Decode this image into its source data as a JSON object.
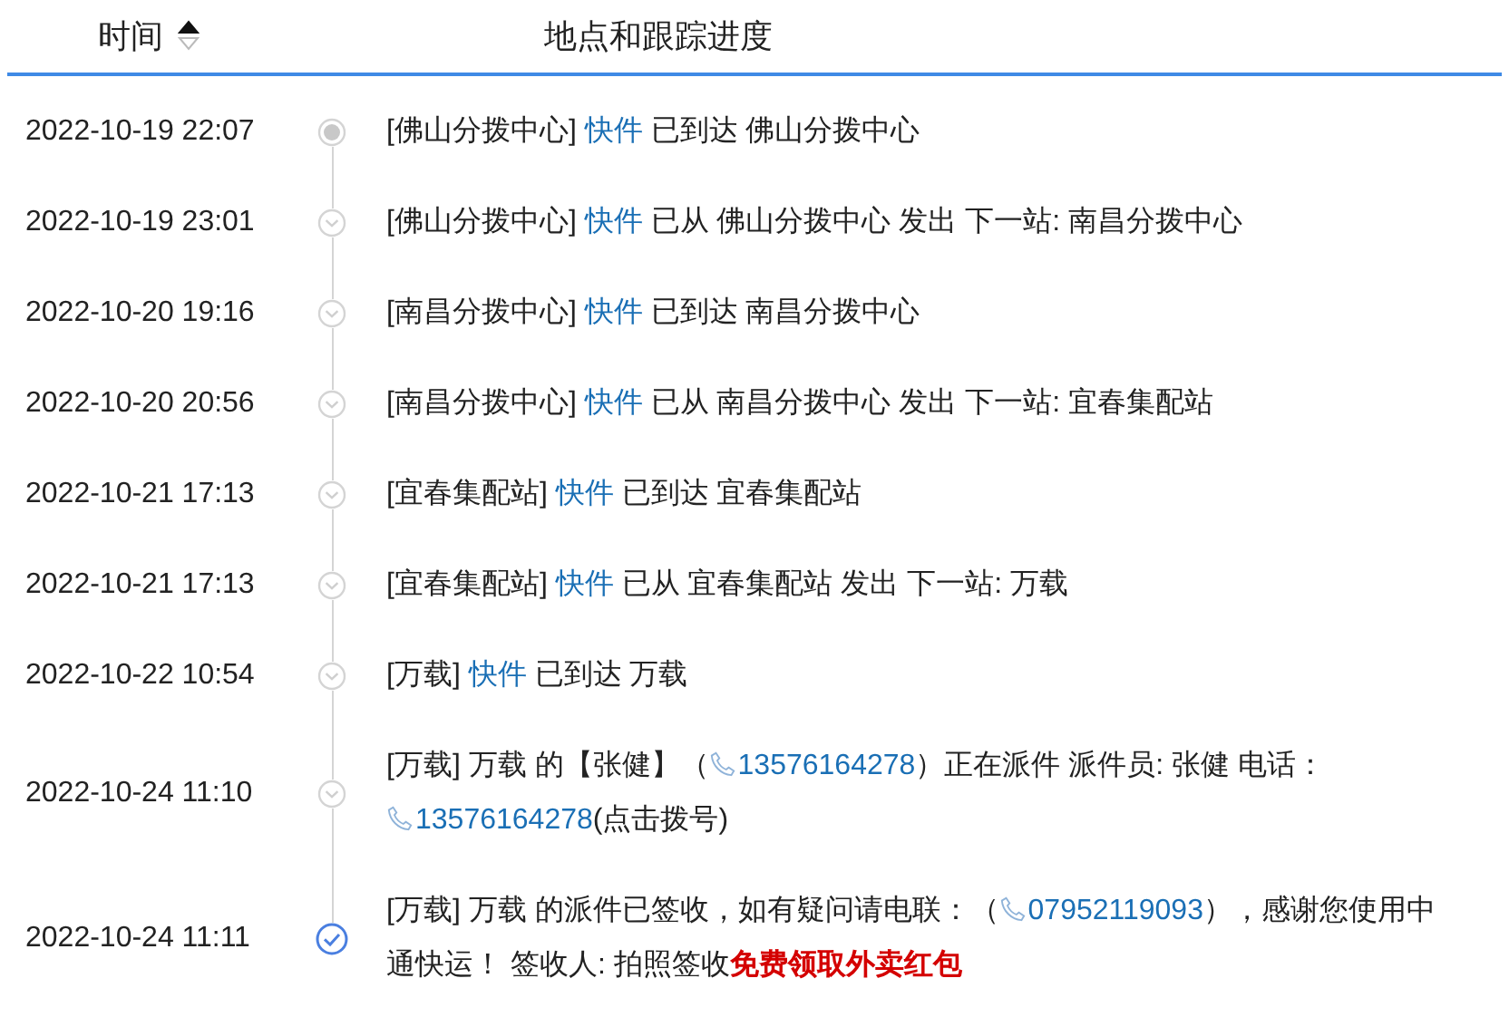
{
  "header": {
    "time_column": "时间",
    "sorted_ascending": true,
    "detail_column": "地点和跟踪进度"
  },
  "events": [
    {
      "time": "2022-10-19 22:07",
      "kind": "start",
      "segments": [
        {
          "kind": "text",
          "text": "[佛山分拨中心] "
        },
        {
          "kind": "link",
          "text": "快件"
        },
        {
          "kind": "text",
          "text": " 已到达 佛山分拨中心"
        }
      ]
    },
    {
      "time": "2022-10-19 23:01",
      "kind": "step",
      "segments": [
        {
          "kind": "text",
          "text": "[佛山分拨中心] "
        },
        {
          "kind": "link",
          "text": "快件"
        },
        {
          "kind": "text",
          "text": " 已从 佛山分拨中心 发出 下一站: 南昌分拨中心"
        }
      ]
    },
    {
      "time": "2022-10-20 19:16",
      "kind": "step",
      "segments": [
        {
          "kind": "text",
          "text": "[南昌分拨中心] "
        },
        {
          "kind": "link",
          "text": "快件"
        },
        {
          "kind": "text",
          "text": " 已到达 南昌分拨中心"
        }
      ]
    },
    {
      "time": "2022-10-20 20:56",
      "kind": "step",
      "segments": [
        {
          "kind": "text",
          "text": "[南昌分拨中心] "
        },
        {
          "kind": "link",
          "text": "快件"
        },
        {
          "kind": "text",
          "text": " 已从 南昌分拨中心 发出 下一站: 宜春集配站"
        }
      ]
    },
    {
      "time": "2022-10-21 17:13",
      "kind": "step",
      "segments": [
        {
          "kind": "text",
          "text": "[宜春集配站] "
        },
        {
          "kind": "link",
          "text": "快件"
        },
        {
          "kind": "text",
          "text": " 已到达 宜春集配站"
        }
      ]
    },
    {
      "time": "2022-10-21 17:13",
      "kind": "step",
      "segments": [
        {
          "kind": "text",
          "text": "[宜春集配站] "
        },
        {
          "kind": "link",
          "text": "快件"
        },
        {
          "kind": "text",
          "text": " 已从 宜春集配站 发出 下一站: 万载"
        }
      ]
    },
    {
      "time": "2022-10-22 10:54",
      "kind": "step",
      "segments": [
        {
          "kind": "text",
          "text": "[万载] "
        },
        {
          "kind": "link",
          "text": "快件"
        },
        {
          "kind": "text",
          "text": " 已到达 万载"
        }
      ]
    },
    {
      "time": "2022-10-24 11:10",
      "kind": "step",
      "segments": [
        {
          "kind": "text",
          "text": "[万载] 万载 的【张健】（"
        },
        {
          "kind": "phone",
          "text": "13576164278"
        },
        {
          "kind": "text",
          "text": "）正在派件 派件员: 张健 电话："
        },
        {
          "kind": "phone",
          "text": "13576164278"
        },
        {
          "kind": "text",
          "text": "(点击拨号)"
        }
      ]
    },
    {
      "time": "2022-10-24 11:11",
      "kind": "done",
      "segments": [
        {
          "kind": "text",
          "text": "[万载] 万载 的派件已签收，如有疑问请电联：（"
        },
        {
          "kind": "phone",
          "text": "07952119093"
        },
        {
          "kind": "text",
          "text": "），感谢您使用中通快运！ 签收人: 拍照签收"
        },
        {
          "kind": "promo",
          "text": "免费领取外卖红包"
        }
      ]
    }
  ]
}
